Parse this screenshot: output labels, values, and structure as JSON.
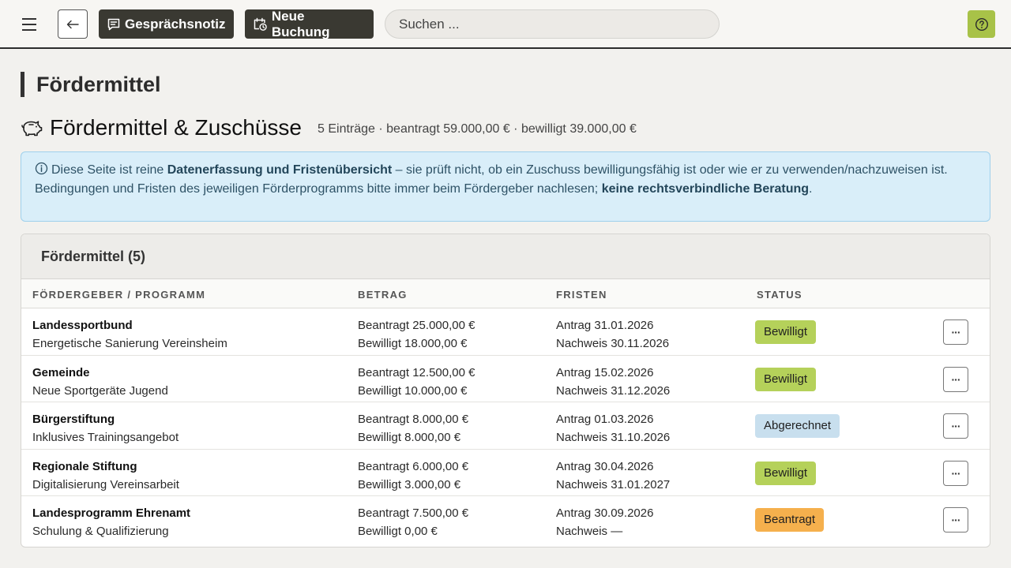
{
  "toolbar": {
    "note_label": "Gesprächsnotiz",
    "booking_label": "Neue Buchung",
    "search_placeholder": "Suchen ..."
  },
  "page": {
    "title": "Fördermittel",
    "section_title": "Fördermittel & Zuschüsse",
    "summary": "5 Einträge · beantragt 59.000,00 € · bewilligt 39.000,00 €"
  },
  "info": {
    "p1": "Diese Seite ist reine ",
    "b1": "Datenerfassung und Fristenübersicht",
    "p2": " – sie prüft nicht, ob ein Zuschuss bewilligungsfähig ist oder wie er zu verwenden/nachzuweisen ist. Bedingungen und Fristen des jeweiligen Förderprogramms bitte immer beim Fördergeber nachlesen; ",
    "b2": "keine rechtsver­bindliche Beratung",
    "p3": "."
  },
  "table": {
    "title": "Fördermittel (5)",
    "columns": [
      "FÖRDERGEBER / PROGRAMM",
      "BETRAG",
      "FRISTEN",
      "STATUS"
    ],
    "rows": [
      {
        "grantor": "Landessportbund",
        "program": "Energetische Sanierung Vereinsheim",
        "requested": "Beantragt 25.000,00 €",
        "approved": "Bewilligt 18.000,00 €",
        "deadline_apply": "Antrag 31.01.2026",
        "deadline_proof": "Nachweis 30.11.2026",
        "status": "Bewilligt"
      },
      {
        "grantor": "Gemeinde",
        "program": "Neue Sportgeräte Jugend",
        "requested": "Beantragt 12.500,00 €",
        "approved": "Bewilligt 10.000,00 €",
        "deadline_apply": "Antrag 15.02.2026",
        "deadline_proof": "Nachweis 31.12.2026",
        "status": "Bewilligt"
      },
      {
        "grantor": "Bürgerstiftung",
        "program": "Inklusives Trainingsangebot",
        "requested": "Beantragt 8.000,00 €",
        "approved": "Bewilligt 8.000,00 €",
        "deadline_apply": "Antrag 01.03.2026",
        "deadline_proof": "Nachweis 31.10.2026",
        "status": "Abgerechnet"
      },
      {
        "grantor": "Regionale Stiftung",
        "program": "Digitalisierung Vereinsarbeit",
        "requested": "Beantragt 6.000,00 €",
        "approved": "Bewilligt 3.000,00 €",
        "deadline_apply": "Antrag 30.04.2026",
        "deadline_proof": "Nachweis 31.01.2027",
        "status": "Bewilligt"
      },
      {
        "grantor": "Landesprogramm Ehrenamt",
        "program": "Schulung & Qualifizierung",
        "requested": "Beantragt 7.500,00 €",
        "approved": "Bewilligt 0,00 €",
        "deadline_apply": "Antrag 30.09.2026",
        "deadline_proof": "Nachweis —",
        "status": "Beantragt"
      }
    ],
    "more_label": "···"
  },
  "colors": {
    "status_approved": "#b5d15a",
    "status_settled": "#c8dfee",
    "status_requested": "#f5b04d",
    "help_button": "#a8c248"
  },
  "icons": [
    "menu-icon",
    "arrow-left-icon",
    "note-icon",
    "calendar-clock-icon",
    "help-icon",
    "piggy-bank-icon",
    "info-icon",
    "more-icon"
  ]
}
